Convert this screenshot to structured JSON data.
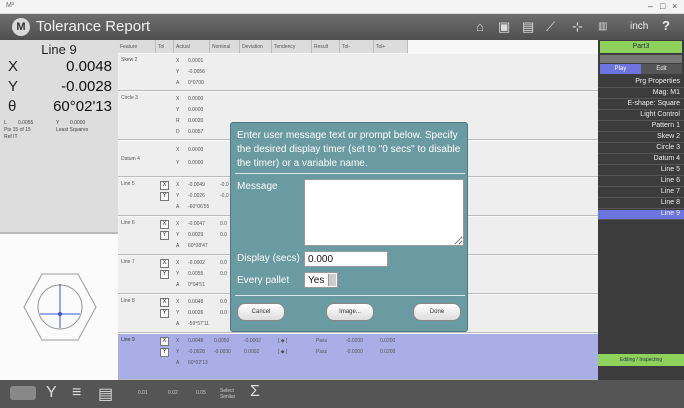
{
  "window": {
    "title": "Tolerance Report",
    "logo": "M",
    "minimize": "–",
    "maximize": "□",
    "close": "×",
    "corner": "M³"
  },
  "toolbar": {
    "unit": "inch",
    "help": "?",
    "icons": [
      "home-icon",
      "camera-icon",
      "display-icon",
      "probe-icon",
      "axis-icon",
      "ruler-icon"
    ]
  },
  "left": {
    "feature": "Line 9",
    "x_label": "X",
    "x_value": "0.0048",
    "y_label": "Y",
    "y_value": "-0.0028",
    "t_label": "θ",
    "t_value": "60°02'13",
    "stats": [
      "L",
      "0.0055",
      "Y",
      "0.0000"
    ],
    "pts": "Pts 15 of 15",
    "fit": "Least Squares",
    "ref": "Ref IT"
  },
  "table": {
    "headers": [
      "Feature",
      "Tol",
      "Actual",
      "Nominal",
      "Deviation",
      "Tendency",
      "Result",
      "Tol-",
      "Tol+"
    ],
    "rows": [
      {
        "feature": "Skew 2",
        "lines": [
          [
            "X",
            "0.0001"
          ],
          [
            "Y",
            "-0.0056"
          ],
          [
            "A",
            "0°0700"
          ]
        ]
      },
      {
        "feature": "Circle 3",
        "lines": [
          [
            "X",
            "0.0000"
          ],
          [
            "Y",
            "0.0000"
          ],
          [
            "R",
            "0.0020"
          ],
          [
            "D",
            "0.0057"
          ]
        ]
      },
      {
        "feature": "Datum 4",
        "lines": [
          [
            "X",
            "0.0000"
          ],
          [
            "Y",
            "0.0000"
          ]
        ]
      },
      {
        "feature": "Line 5",
        "lines": [
          [
            "X",
            "-0.0049",
            "-0.0"
          ],
          [
            "Y",
            "-0.0026",
            "-0.0"
          ],
          [
            "A",
            "-60°06'55"
          ]
        ]
      },
      {
        "feature": "Line 6",
        "lines": [
          [
            "X",
            "-0.0047",
            "0.0"
          ],
          [
            "Y",
            "0.0029",
            "0.0"
          ],
          [
            "A",
            "60°08'47"
          ]
        ]
      },
      {
        "feature": "Line 7",
        "lines": [
          [
            "X",
            "-0.0002",
            "0.0"
          ],
          [
            "Y",
            "0.0055",
            "0.0"
          ],
          [
            "A",
            "0°04'51"
          ]
        ]
      },
      {
        "feature": "Line 8",
        "lines": [
          [
            "X",
            "0.0048",
            "0.0"
          ],
          [
            "Y",
            "0.0026",
            "0.0"
          ],
          [
            "A",
            "-59°57'11"
          ]
        ]
      },
      {
        "feature": "Line 9",
        "lines": [
          [
            "X",
            "0.0048",
            "0.0050",
            "-0.0002",
            "Pass",
            "-0.0200",
            "0.0200"
          ],
          [
            "Y",
            "-0.0028",
            "-0.0030",
            "0.0002",
            "Pass",
            "-0.0200",
            "0.0200"
          ],
          [
            "A",
            "60°02'13"
          ]
        ]
      }
    ]
  },
  "right": {
    "part": "Part3",
    "play": "Play",
    "edit": "Edit",
    "items": [
      "Prg Properties",
      "Mag: M1",
      "E-shape: Square",
      "Light Control",
      "Pattern 1",
      "Skew 2",
      "Circle 3",
      "Datum 4",
      "Line 5",
      "Line 6",
      "Line 7",
      "Line 8",
      "Line 9"
    ],
    "status": "Editing / Inspecting"
  },
  "bottom": {
    "labels": [
      "0.01",
      "0.02",
      "0.05",
      "Select\nSimilar"
    ]
  },
  "dialog": {
    "text": "Enter user message text or prompt below.  Specify the desired display timer (set to \"0 secs\" to disable the timer) or a variable name.",
    "message_label": "Message",
    "display_label": "Display (secs)",
    "display_value": "0.000",
    "pallet_label": "Every pallet",
    "pallet_value": "Yes",
    "cancel": "Cancel",
    "image": "Image...",
    "done": "Done"
  },
  "colors": {
    "dialog": "#6a9aa2",
    "highlight": "#a9aee6",
    "accent": "#8ed25c",
    "selected": "#6c74e0"
  }
}
